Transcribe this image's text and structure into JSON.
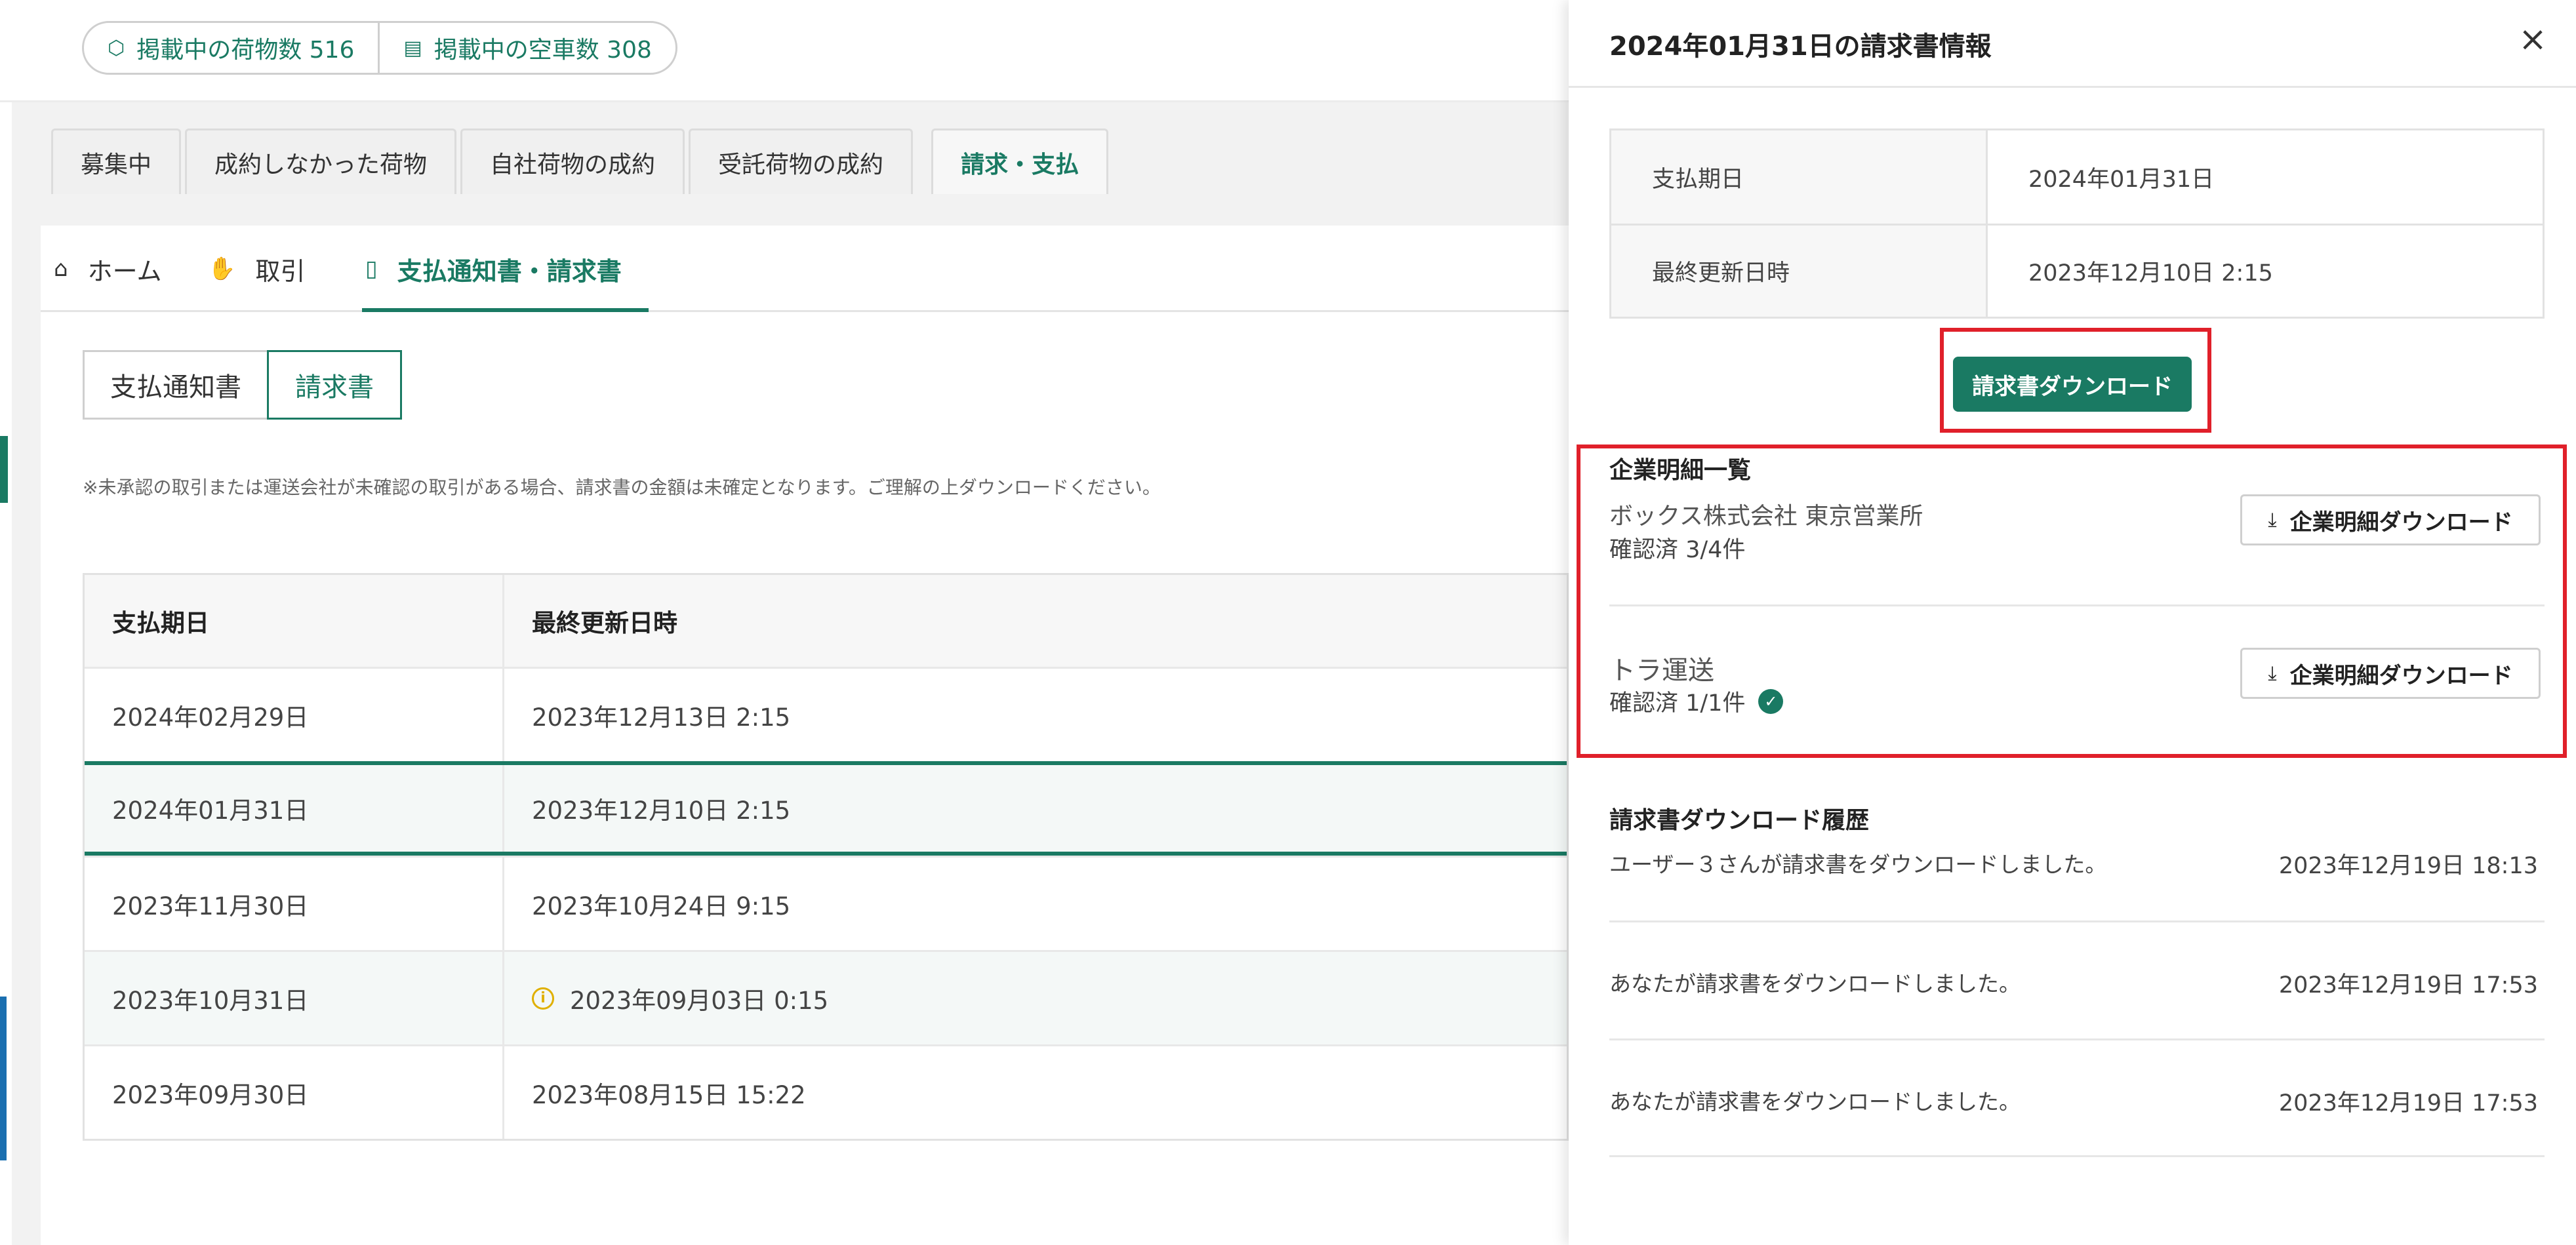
{
  "header": {
    "listings_label": "掲載中の荷物数 516",
    "trucks_label": "掲載中の空車数 308",
    "listings_icon": "package-icon",
    "trucks_icon": "truck-icon"
  },
  "tabs": [
    "募集中",
    "成約しなかった荷物",
    "自社荷物の成約",
    "受託荷物の成約",
    "請求・支払"
  ],
  "subnav": {
    "home": "ホーム",
    "deals": "取引",
    "docs": "支払通知書・請求書"
  },
  "segments": {
    "payment_notice": "支払通知書",
    "invoice": "請求書"
  },
  "notice": "※未承認の取引または運送会社が未確認の取引がある場合、請求書の金額は未確定となります。ご理解の上ダウンロードください。",
  "table": {
    "headers": [
      "支払期日",
      "最終更新日時"
    ],
    "rows": [
      {
        "due": "2024年02月29日",
        "updated": "2023年12月13日 2:15"
      },
      {
        "due": "2024年01月31日",
        "updated": "2023年12月10日 2:15"
      },
      {
        "due": "2023年11月30日",
        "updated": "2023年10月24日 9:15"
      },
      {
        "due": "2023年10月31日",
        "updated": "2023年09月03日 0:15"
      },
      {
        "due": "2023年09月30日",
        "updated": "2023年08月15日 15:22"
      }
    ]
  },
  "drawer": {
    "title": "2024年01月31日の請求書情報",
    "close": "×",
    "info": [
      {
        "key": "支払期日",
        "value": "2024年01月31日"
      },
      {
        "key": "最終更新日時",
        "value": "2023年12月10日 2:15"
      }
    ],
    "download_button": "請求書ダウンロード",
    "company_section_title": "企業明細一覧",
    "companies": [
      {
        "name": "ボックス株式会社 東京営業所",
        "status": "確認済 3/4件",
        "button": "企業明細ダウンロード"
      },
      {
        "name": "トラ運送",
        "status": "確認済 1/1件",
        "button": "企業明細ダウンロード"
      }
    ],
    "history_title": "請求書ダウンロード履歴",
    "history": [
      {
        "text": "ユーザー３さんが請求書をダウンロードしました。",
        "time": "2023年12月19日 18:13"
      },
      {
        "text": "あなたが請求書をダウンロードしました。",
        "time": "2023年12月19日 17:53"
      },
      {
        "text": "あなたが請求書をダウンロードしました。",
        "time": "2023年12月19日 17:53"
      }
    ]
  },
  "colors": {
    "accent": "#1a7a63",
    "highlight_frame": "#e0202a",
    "warning": "#e0b000"
  }
}
